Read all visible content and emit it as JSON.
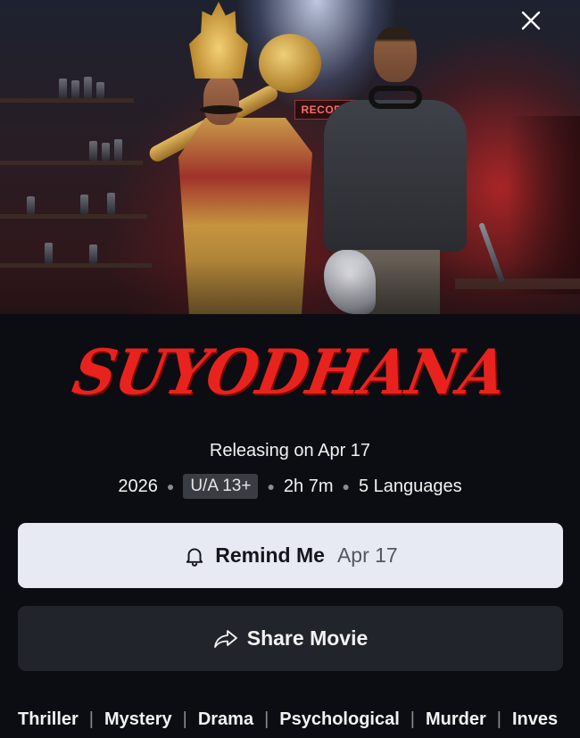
{
  "hero": {
    "sign_text": "RECORD"
  },
  "movie": {
    "title": "SUYODHANA",
    "release_line": "Releasing on Apr 17",
    "year": "2026",
    "rating": "U/A 13+",
    "duration": "2h 7m",
    "languages": "5 Languages"
  },
  "actions": {
    "remind_label": "Remind Me",
    "remind_date": "Apr 17",
    "share_label": "Share Movie"
  },
  "genres": [
    "Thriller",
    "Mystery",
    "Drama",
    "Psychological",
    "Murder",
    "Inves"
  ],
  "icons": {
    "close": "close-icon",
    "bell": "bell-icon",
    "share": "share-arrow-icon"
  },
  "colors": {
    "title_red": "#e8231e",
    "remind_bg": "#e7e9f3",
    "share_bg": "#22242b",
    "page_bg": "#0c0d12"
  }
}
